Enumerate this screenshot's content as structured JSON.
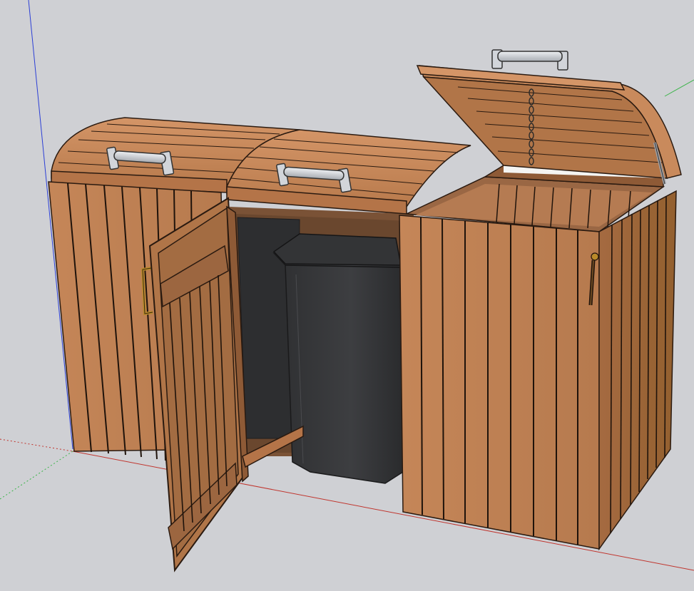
{
  "viewport": {
    "background": "#cfd0d4"
  },
  "colors": {
    "axis_red": "#c0352e",
    "axis_green": "#3cb44a",
    "axis_blue": "#2c3fd6",
    "wood_light": "#c98a5c",
    "wood_mid": "#b47448",
    "wood_dark": "#8e5a36",
    "wood_inner": "#7a5236",
    "plank_line": "#2a1a10",
    "bin_body": "#3a3b3d",
    "bin_lid": "#2f3032",
    "handle_grey": "#c9ccd1",
    "brass": "#b98a2a",
    "shadow": "#353536"
  },
  "scene": {
    "model": "triple-bin-store",
    "bins": [
      {
        "name": "left-bin-bay",
        "lid": "closed",
        "door": "closed"
      },
      {
        "name": "middle-bin-bay",
        "lid": "closed",
        "door": "open"
      },
      {
        "name": "right-bin-bay",
        "lid": "open",
        "door": "closed"
      }
    ],
    "icons": [
      "lid-handle-icon",
      "door-handle-icon",
      "chain-icon",
      "gas-strut-icon"
    ]
  }
}
